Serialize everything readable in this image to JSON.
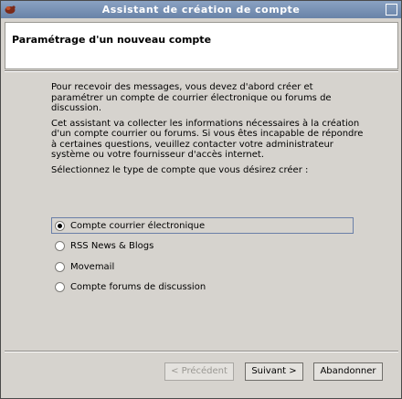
{
  "window": {
    "title": "Assistant de création de compte"
  },
  "header": {
    "title": "Paramétrage d'un nouveau compte"
  },
  "content": {
    "paragraph1": "Pour recevoir des messages, vous devez d'abord créer et paramétrer un compte de courrier électronique ou forums de discussion.",
    "paragraph2": "Cet assistant va collecter les informations nécessaires à la création d'un compte courrier ou forums. Si vous êtes incapable de répondre à certaines questions, veuillez contacter votre administrateur système ou votre fournisseur d'accès internet.",
    "prompt": "Sélectionnez le type de compte que vous désirez créer :"
  },
  "account_types": [
    {
      "label": "Compte courrier électronique",
      "selected": true
    },
    {
      "label": "RSS News & Blogs",
      "selected": false
    },
    {
      "label": "Movemail",
      "selected": false
    },
    {
      "label": "Compte forums de discussion",
      "selected": false
    }
  ],
  "buttons": {
    "back": "< Précédent",
    "next": "Suivant >",
    "cancel": "Abandonner"
  },
  "colors": {
    "titlebar": "#7b93b8",
    "background": "#d6d3ce",
    "focus_border": "#6a7fa8"
  }
}
